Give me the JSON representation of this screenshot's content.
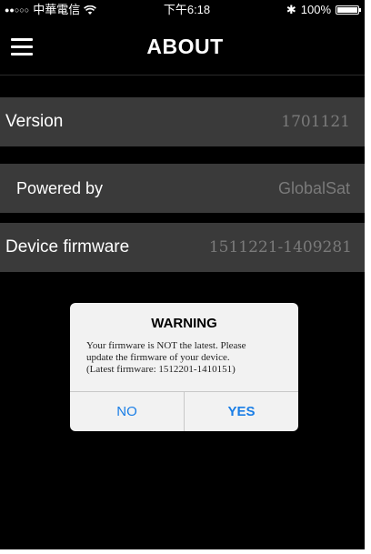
{
  "status_bar": {
    "signal": "●●○○○",
    "carrier": "中華電信",
    "time": "下午6:18",
    "bluetooth_symbol": "✱",
    "battery_percent": "100%",
    "battery_level": 1.0,
    "icons": [
      "wifi-icon",
      "bluetooth-icon",
      "battery-icon"
    ]
  },
  "nav": {
    "title": "ABOUT",
    "menu_icon": "hamburger-menu-icon"
  },
  "rows": {
    "version": {
      "label": "Version",
      "value": "1701121"
    },
    "powered_by": {
      "label": "Powered by",
      "value": "GlobalSat"
    },
    "device_firmware": {
      "label": "Device firmware",
      "value": "1511221-1409281"
    }
  },
  "dialog": {
    "title": "WARNING",
    "message_line1": "Your firmware is NOT the latest. Please",
    "message_line2": "update the firmware of your device.",
    "message_line3": "(Latest firmware: 1512201-1410151)",
    "no_label": "NO",
    "yes_label": "YES"
  },
  "colors": {
    "background": "#000000",
    "row_background": "#3a3a3a",
    "value_text": "#7a7a7a",
    "dialog_background": "#f2f2f2",
    "accent": "#1a7ee6"
  }
}
